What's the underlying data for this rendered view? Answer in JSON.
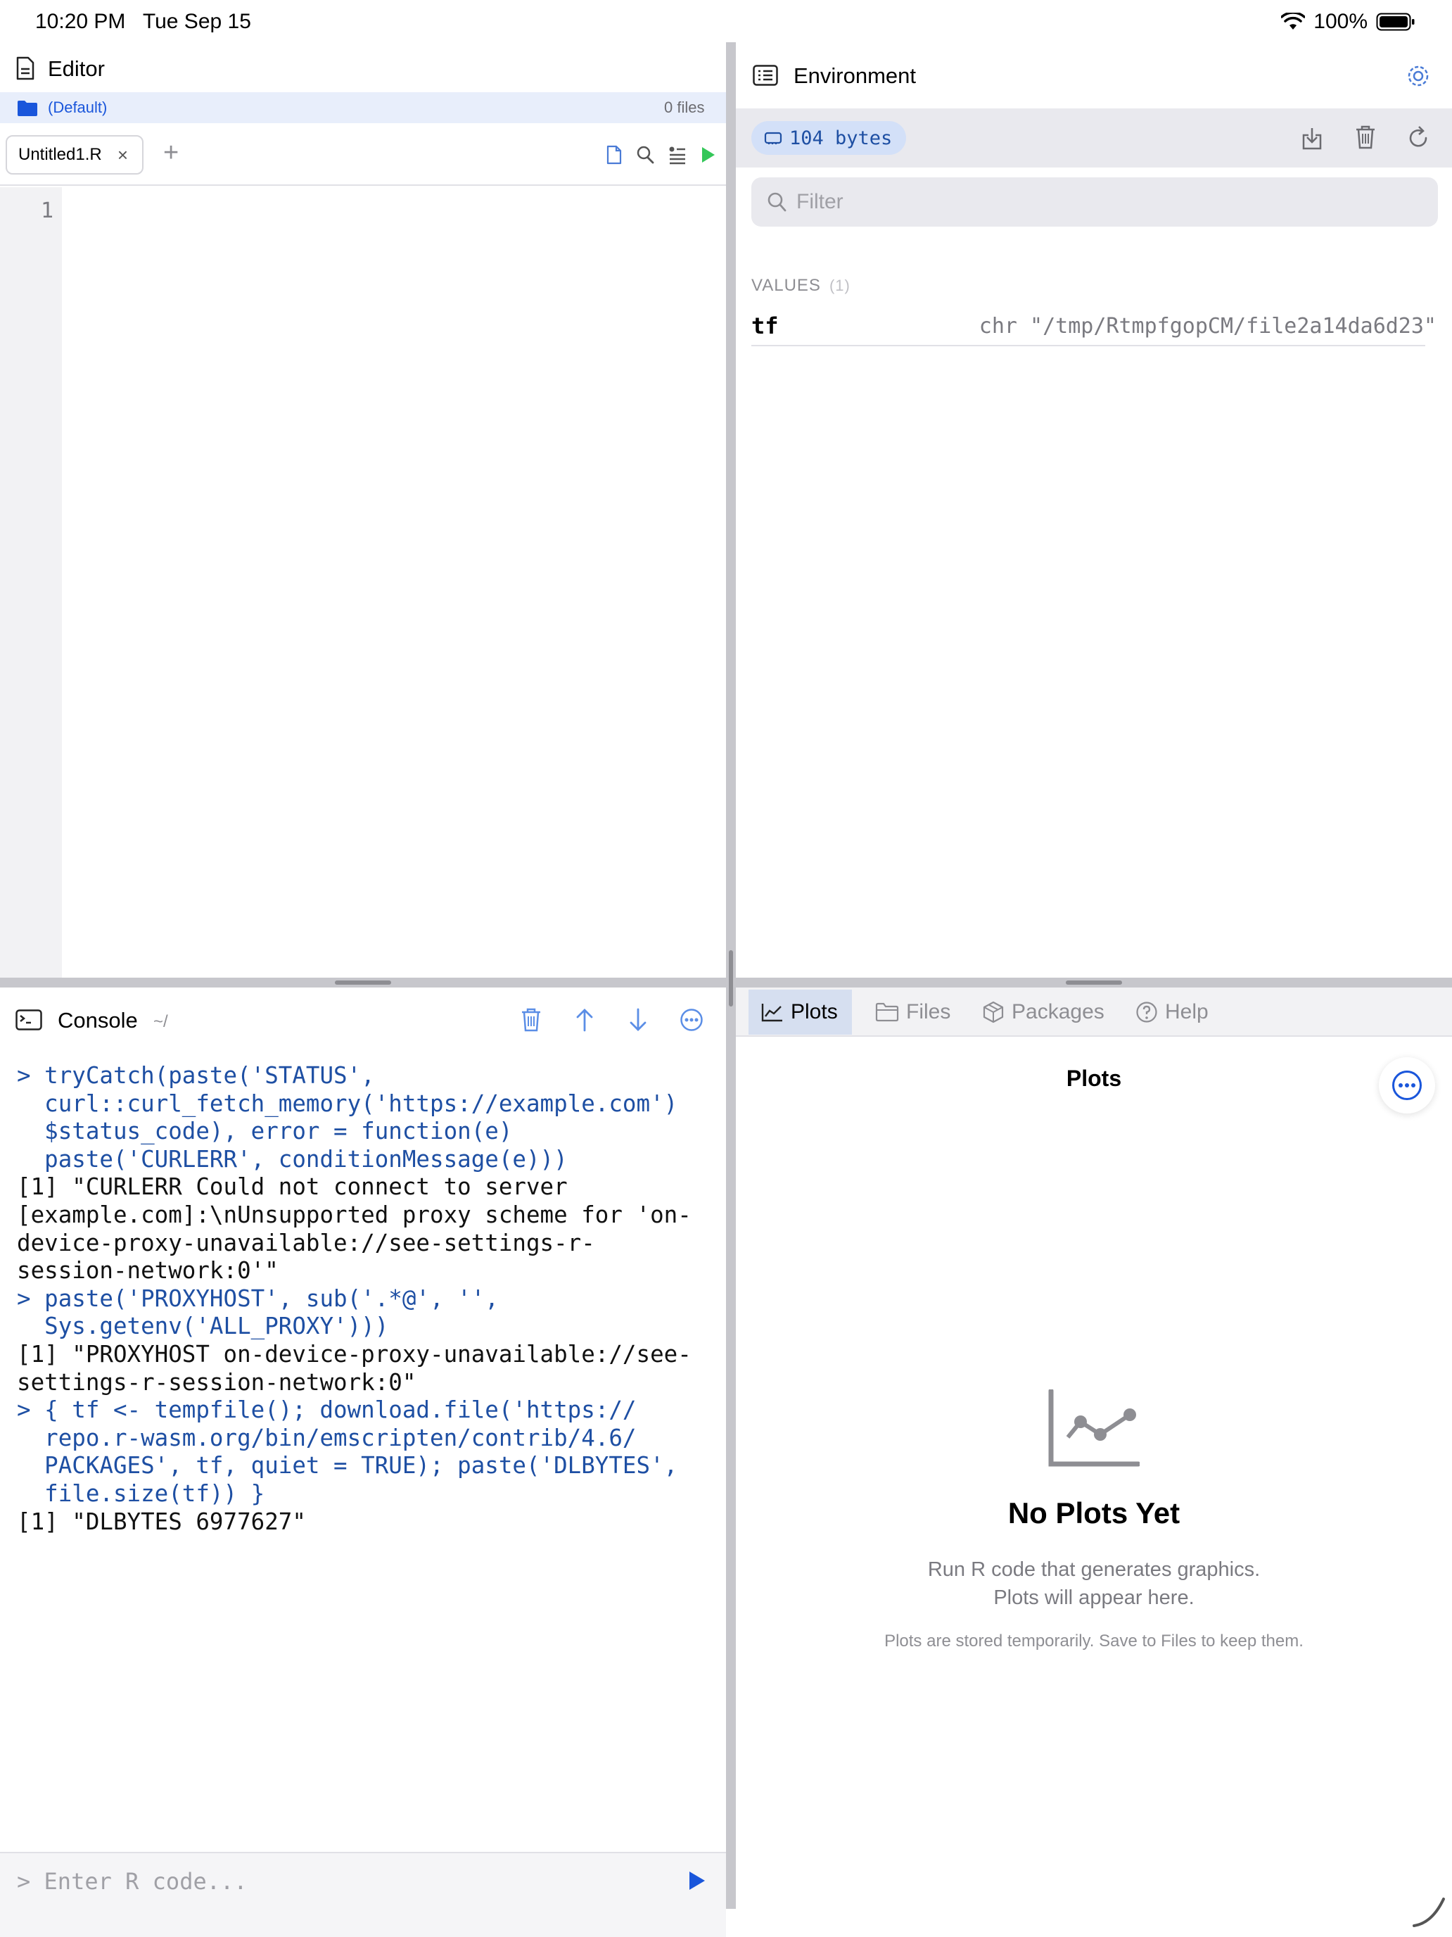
{
  "status_bar": {
    "time": "10:20 PM",
    "date": "Tue Sep 15",
    "battery": "100%"
  },
  "editor": {
    "title": "Editor",
    "folder": "(Default)",
    "file_count": "0 files",
    "tabs": [
      {
        "label": "Untitled1.R"
      }
    ],
    "line_numbers": [
      "1"
    ]
  },
  "console": {
    "title": "Console",
    "path": "~/",
    "lines": [
      {
        "kind": "in",
        "text": "> tryCatch(paste('STATUS',"
      },
      {
        "kind": "in",
        "text": "  curl::curl_fetch_memory('https://example.com')"
      },
      {
        "kind": "in",
        "text": "  $status_code), error = function(e)"
      },
      {
        "kind": "in",
        "text": "  paste('CURLERR', conditionMessage(e)))"
      },
      {
        "kind": "out",
        "text": "[1] \"CURLERR Could not connect to server"
      },
      {
        "kind": "out",
        "text": "[example.com]:\\nUnsupported proxy scheme for 'on-"
      },
      {
        "kind": "out",
        "text": "device-proxy-unavailable://see-settings-r-"
      },
      {
        "kind": "out",
        "text": "session-network:0'\""
      },
      {
        "kind": "in",
        "text": "> paste('PROXYHOST', sub('.*@', '',"
      },
      {
        "kind": "in",
        "text": "  Sys.getenv('ALL_PROXY')))"
      },
      {
        "kind": "out",
        "text": "[1] \"PROXYHOST on-device-proxy-unavailable://see-"
      },
      {
        "kind": "out",
        "text": "settings-r-session-network:0\""
      },
      {
        "kind": "in",
        "text": "> { tf <- tempfile(); download.file('https://"
      },
      {
        "kind": "in",
        "text": "  repo.r-wasm.org/bin/emscripten/contrib/4.6/"
      },
      {
        "kind": "in",
        "text": "  PACKAGES', tf, quiet = TRUE); paste('DLBYTES',"
      },
      {
        "kind": "in",
        "text": "  file.size(tf)) }"
      },
      {
        "kind": "out",
        "text": "[1] \"DLBYTES 6977627\""
      }
    ],
    "input_placeholder": "> Enter R code..."
  },
  "environment": {
    "title": "Environment",
    "memory": "104 bytes",
    "filter_placeholder": "Filter",
    "section_label": "VALUES",
    "section_count": "(1)",
    "variables": [
      {
        "name": "tf",
        "value": "chr \"/tmp/RtmpfgopCM/file2a14da6d23\""
      }
    ]
  },
  "bottom_panel": {
    "tabs": [
      {
        "label": "Plots",
        "active": true
      },
      {
        "label": "Files",
        "active": false
      },
      {
        "label": "Packages",
        "active": false
      },
      {
        "label": "Help",
        "active": false
      }
    ],
    "plots_header": "Plots",
    "empty_title": "No Plots Yet",
    "empty_line1": "Run R code that generates graphics.",
    "empty_line2": "Plots will appear here.",
    "empty_note": "Plots are stored temporarily. Save to Files to keep them."
  },
  "colors": {
    "accent": "#1a56db",
    "code_input": "#1e4fa3",
    "run_green": "#34c759"
  }
}
